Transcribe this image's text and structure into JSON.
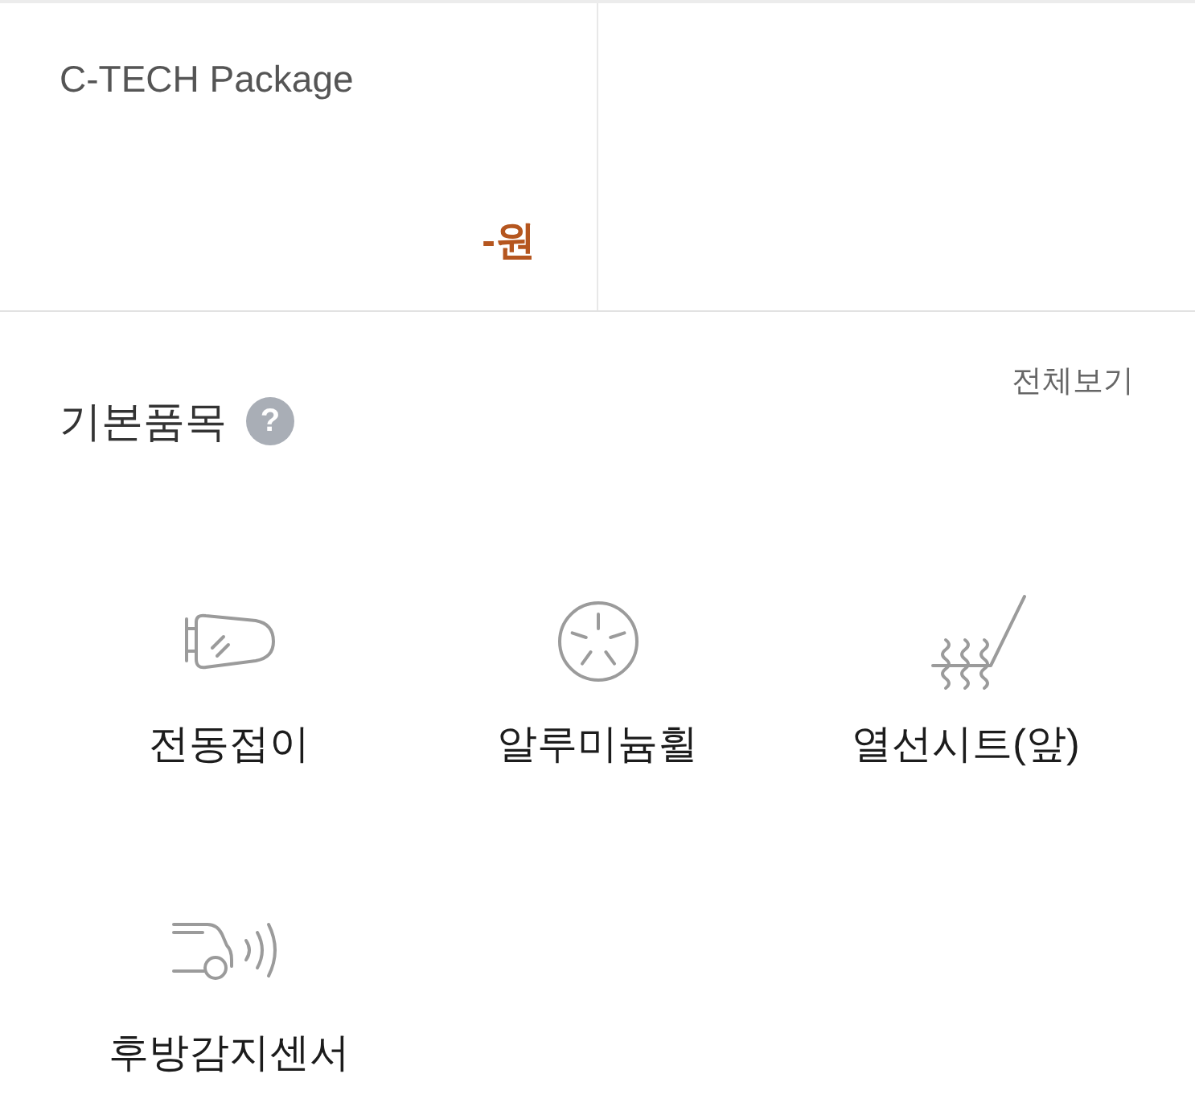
{
  "package": {
    "name": "C-TECH Package",
    "price": "-원"
  },
  "basic_items": {
    "title": "기본품목",
    "help_icon": "?",
    "view_all": "전체보기",
    "items": [
      {
        "kind": "mirror",
        "label": "전동접이"
      },
      {
        "kind": "wheel",
        "label": "알루미늄휠"
      },
      {
        "kind": "heated_seat",
        "label": "열선시트(앞)"
      },
      {
        "kind": "rear_sensor",
        "label": "후방감지센서"
      }
    ]
  }
}
